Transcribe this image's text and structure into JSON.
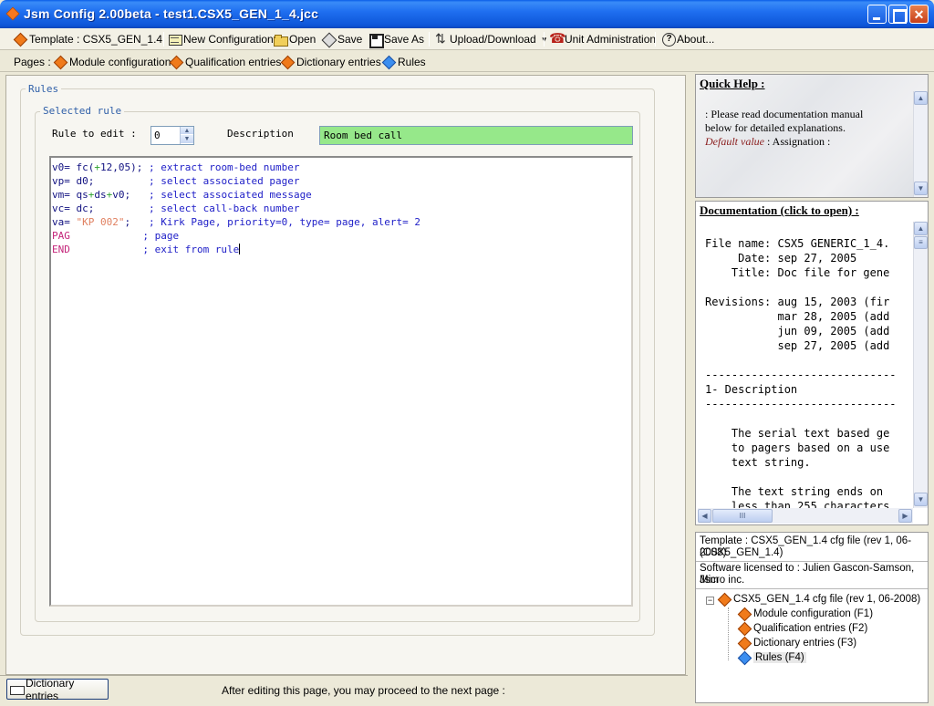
{
  "window": {
    "title": "Jsm Config 2.00beta - test1.CSX5_GEN_1_4.jcc"
  },
  "toolbar": {
    "template_label": "Template : CSX5_GEN_1.4",
    "new_config": "New Configuration",
    "open": "Open",
    "save": "Save",
    "save_as": "Save As",
    "upload_download": "Upload/Download",
    "unit_admin": "Unit Administration",
    "about": "About..."
  },
  "pages": {
    "label": "Pages :",
    "items": [
      "Module configuration",
      "Qualification entries",
      "Dictionary entries",
      "Rules"
    ]
  },
  "rules": {
    "group_title": "Rules",
    "selected_rule_title": "Selected rule",
    "rule_to_edit_label": "Rule to edit :",
    "rule_to_edit_value": "0",
    "description_label": "Description",
    "description_value": "Room bed call",
    "code_lines": [
      [
        [
          "kw",
          "v0= fc("
        ],
        [
          "op",
          "+"
        ],
        [
          "kw",
          "12,05); "
        ],
        [
          "cm",
          "; extract room-bed number"
        ]
      ],
      [
        [
          "kw",
          "vp= d0;         "
        ],
        [
          "cm",
          "; select associated pager"
        ]
      ],
      [
        [
          "kw",
          "vm= qs"
        ],
        [
          "op",
          "+"
        ],
        [
          "kw",
          "ds"
        ],
        [
          "op",
          "+"
        ],
        [
          "kw",
          "v0;   "
        ],
        [
          "cm",
          "; select associated message"
        ]
      ],
      [
        [
          "kw",
          "vc= dc;         "
        ],
        [
          "cm",
          "; select call-back number"
        ]
      ],
      [
        [
          "kw",
          "va= "
        ],
        [
          "str",
          "\"KP 002\""
        ],
        [
          "kw",
          ";   "
        ],
        [
          "cm",
          "; Kirk Page, priority=0, type= page, alert= 2"
        ]
      ],
      [
        [
          "cmd",
          "PAG            "
        ],
        [
          "cm",
          "; page"
        ]
      ],
      [
        [
          "cmd",
          "END            "
        ],
        [
          "cm",
          "; exit from rule"
        ]
      ]
    ]
  },
  "status": {
    "dictionary_button": "Dictionary entries",
    "message": "After editing this page, you may proceed to the next page :"
  },
  "quick_help": {
    "title": "Quick Help :",
    "line1": ": Please read documentation manual",
    "line2": "below for detailed explanations.",
    "default_value": "Default value",
    "assignation": " : Assignation :"
  },
  "documentation": {
    "title": "Documentation (click to open) :",
    "lines": [
      "File name: CSX5 GENERIC_1_4.",
      "     Date: sep 27, 2005",
      "    Title: Doc file for gene",
      "",
      "Revisions: aug 15, 2003 (fir",
      "           mar 28, 2005 (add",
      "           jun 09, 2005 (add",
      "           sep 27, 2005 (add",
      "",
      "-----------------------------",
      "1- Description",
      "-----------------------------",
      "",
      "    The serial text based ge",
      "    to pagers based on a use",
      "    text string.",
      "",
      "    The text string ends on",
      "    less than 255 characters"
    ],
    "hscroll_grip": "III"
  },
  "info": {
    "template_line1": "Template : CSX5_GEN_1.4 cfg file (rev 1, 06-2008)",
    "template_line2": "(CSX5_GEN_1.4)",
    "license_line1": "Software licensed to : Julien Gascon-Samson, Jsm",
    "license_line2": "Micro inc.",
    "tree_root": "CSX5_GEN_1.4 cfg file (rev 1, 06-2008)",
    "tree_children": [
      "Module configuration (F1)",
      "Qualification entries (F2)",
      "Dictionary entries (F3)",
      "Rules (F4)"
    ]
  }
}
